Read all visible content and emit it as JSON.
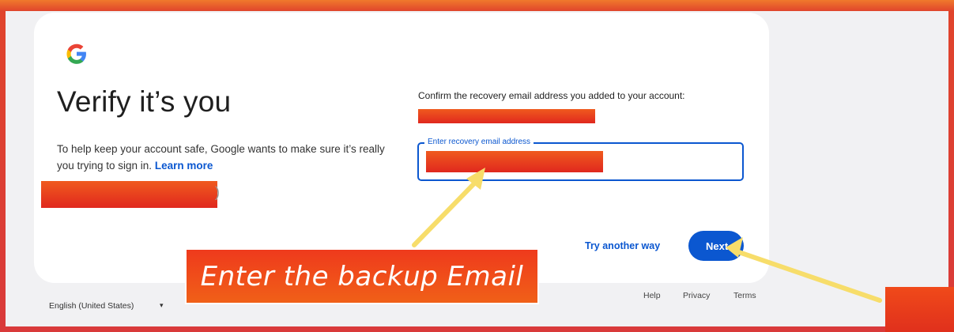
{
  "page": {
    "title": "Verify it’s you",
    "description": "To help keep your account safe, Google wants to make sure it’s really you trying to sign in.",
    "learn_more": "Learn more",
    "paren_char": ")",
    "confirm_prompt": "Confirm the recovery email address you added to your account:",
    "field_label": "Enter recovery email address",
    "try_another_way": "Try another way",
    "next_button": "Next"
  },
  "footer": {
    "language": "English (United States)",
    "caret": "▾",
    "help": "Help",
    "privacy": "Privacy",
    "terms": "Terms"
  },
  "annotation": {
    "callout_text": "Enter the backup Email"
  },
  "colors": {
    "accent": "#0b57d0",
    "redaction": "#e8341e",
    "arrow": "#f7dd6a"
  },
  "icons": {
    "logo": "google-logo-icon"
  }
}
